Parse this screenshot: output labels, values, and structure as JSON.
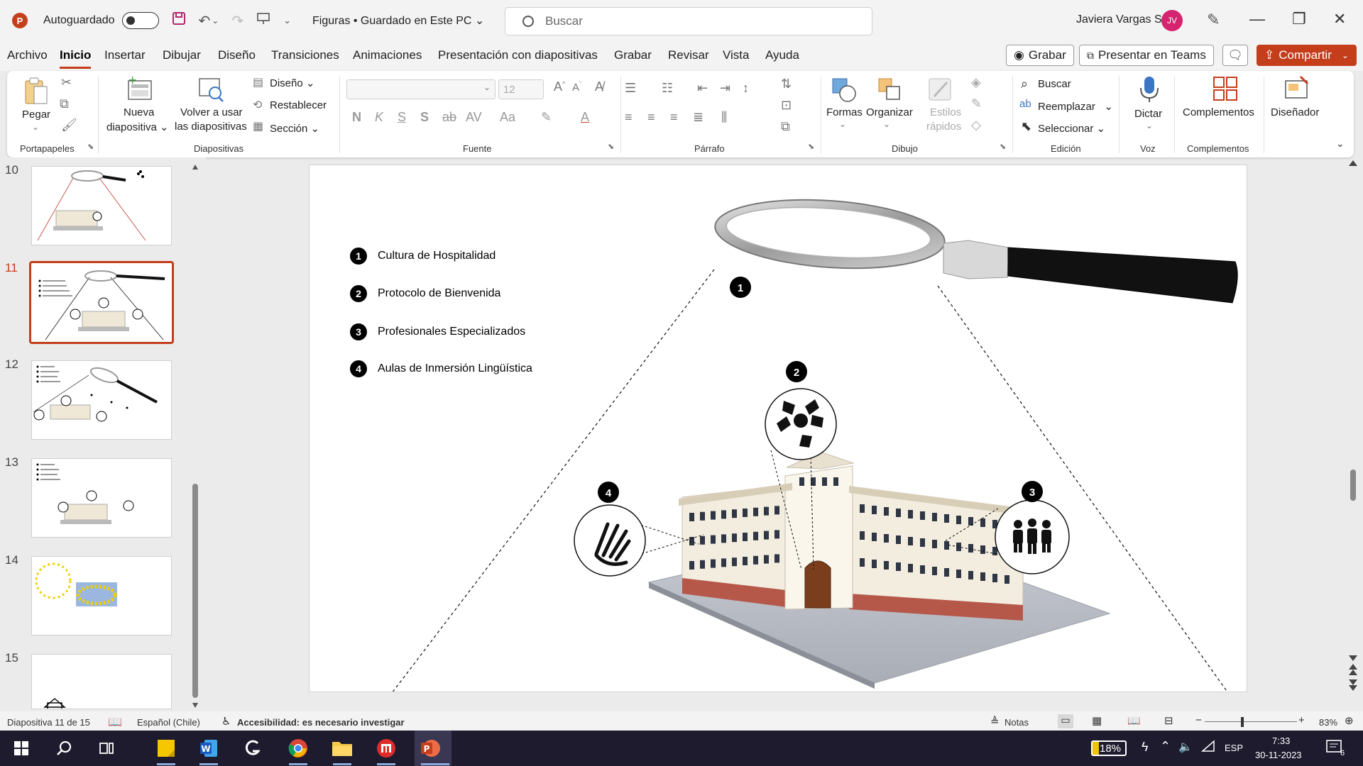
{
  "titlebar": {
    "app_icon": "powerpoint-icon",
    "autosave_label": "Autoguardado",
    "doc_title": "Figuras • Guardado en Este PC",
    "search_placeholder": "Buscar",
    "user_name": "Javiera Vargas S.",
    "avatar_initials": "JV"
  },
  "menu": {
    "tabs": [
      "Archivo",
      "Inicio",
      "Insertar",
      "Dibujar",
      "Diseño",
      "Transiciones",
      "Animaciones",
      "Presentación con diapositivas",
      "Grabar",
      "Revisar",
      "Vista",
      "Ayuda"
    ],
    "active_tab": "Inicio",
    "record_label": "Grabar",
    "teams_label": "Presentar en Teams",
    "share_label": "Compartir"
  },
  "ribbon": {
    "paste_label": "Pegar",
    "clipboard_group": "Portapapeles",
    "new_slide_label_1": "Nueva",
    "new_slide_label_2": "diapositiva",
    "reuse_label_1": "Volver a usar",
    "reuse_label_2": "las diapositivas",
    "layout_label": "Diseño",
    "reset_label": "Restablecer",
    "section_label": "Sección",
    "slides_group": "Diapositivas",
    "font_size": "12",
    "font_group": "Fuente",
    "paragraph_group": "Párrafo",
    "shapes_label": "Formas",
    "arrange_label": "Organizar",
    "quick_styles_label_1": "Estilos",
    "quick_styles_label_2": "rápidos",
    "drawing_group": "Dibujo",
    "find_label": "Buscar",
    "replace_label": "Reemplazar",
    "select_label": "Seleccionar",
    "editing_group": "Edición",
    "dictate_label": "Dictar",
    "voice_group": "Voz",
    "addins_label": "Complementos",
    "addins_group": "Complementos",
    "designer_label": "Diseñador"
  },
  "thumbnails": [
    {
      "number": "10",
      "selected": false
    },
    {
      "number": "11",
      "selected": true
    },
    {
      "number": "12",
      "selected": false
    },
    {
      "number": "13",
      "selected": false
    },
    {
      "number": "14",
      "selected": false
    },
    {
      "number": "15",
      "selected": false
    }
  ],
  "slide": {
    "legend": [
      {
        "num": "1",
        "text": "Cultura de Hospitalidad"
      },
      {
        "num": "2",
        "text": "Protocolo de Bienvenida"
      },
      {
        "num": "3",
        "text": "Profesionales Especializados"
      },
      {
        "num": "4",
        "text": "Aulas de Inmersión Lingüística"
      }
    ],
    "markers": [
      "1",
      "2",
      "3",
      "4"
    ]
  },
  "status": {
    "slide_counter": "Diapositiva 11 de 15",
    "language": "Español (Chile)",
    "accessibility": "Accesibilidad: es necesario investigar",
    "notes_label": "Notas",
    "zoom": "83%"
  },
  "taskbar": {
    "battery": "18%",
    "lang": "ESP",
    "time": "7:33",
    "date": "30-11-2023",
    "notif_count": "6"
  },
  "colors": {
    "accent": "#c43e1c",
    "avatar": "#d6236f",
    "taskbar": "#1e1b2e"
  }
}
